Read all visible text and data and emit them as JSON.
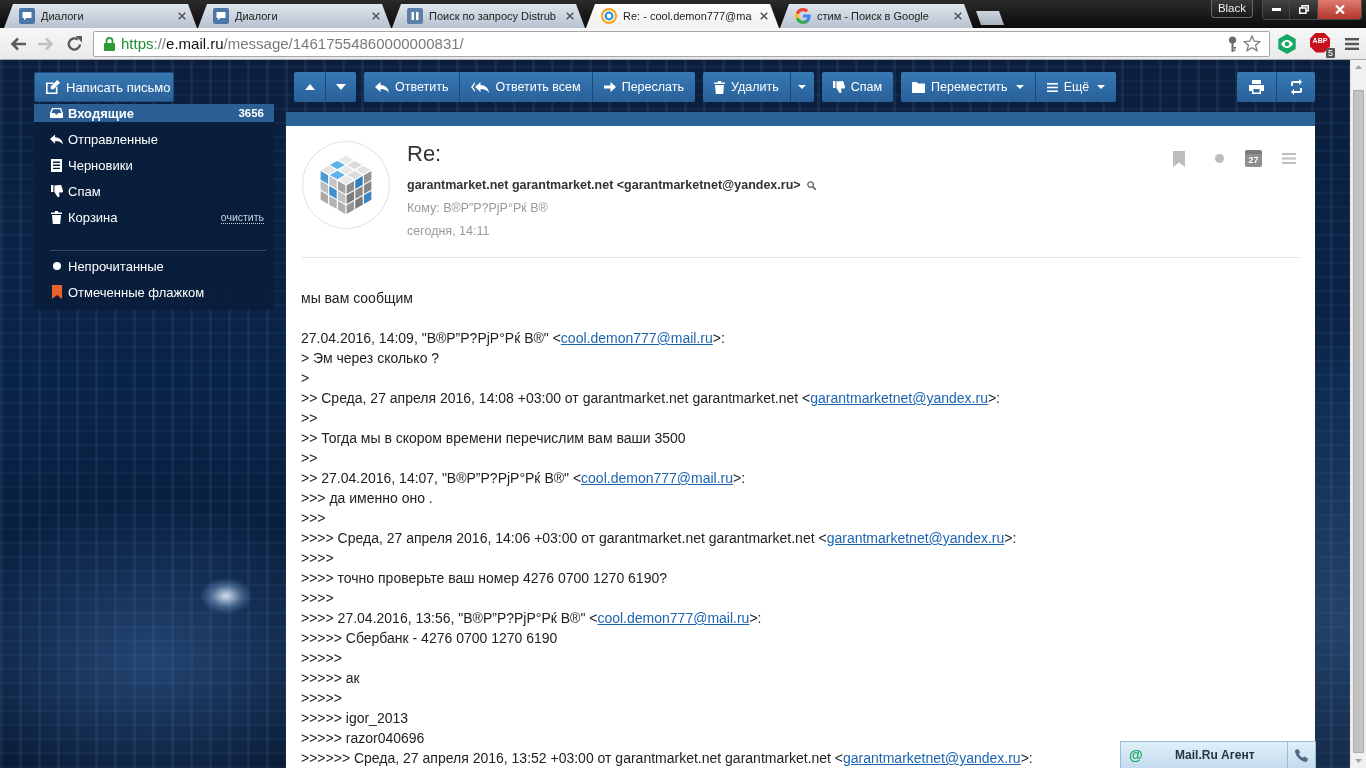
{
  "browser": {
    "tabs": [
      {
        "title": "Диалоги",
        "kind": "dialog",
        "selected": false
      },
      {
        "title": "Диалоги",
        "kind": "dialog",
        "selected": false
      },
      {
        "title": "Поиск по запросу Distrub",
        "kind": "pause",
        "selected": false
      },
      {
        "title": "Re: - cool.demon777@ma",
        "kind": "mail",
        "selected": true
      },
      {
        "title": "стим - Поиск в Google",
        "kind": "google",
        "selected": false
      }
    ],
    "profile": "Black",
    "nav": [
      {
        "kind": "back",
        "disabled": false
      },
      {
        "kind": "forward",
        "disabled": true
      },
      {
        "kind": "reload",
        "disabled": false
      }
    ],
    "url": {
      "scheme": "https",
      "separator": "://",
      "host": "e.mail.ru",
      "path": "/message/14617554860000000831/"
    },
    "adblock": {
      "label": "ABP",
      "count": "5"
    }
  },
  "sidebar": {
    "compose": "Написать письмо",
    "folders": [
      {
        "kind": "inbox",
        "label": "Входящие",
        "count": "3656",
        "selected": true
      },
      {
        "kind": "sent",
        "label": "Отправленные",
        "selected": false
      },
      {
        "kind": "drafts",
        "label": "Черновики",
        "selected": false
      },
      {
        "kind": "spam",
        "label": "Спам",
        "selected": false
      },
      {
        "kind": "trash",
        "label": "Корзина",
        "action": "очистить",
        "selected": false
      }
    ],
    "filters": [
      {
        "kind": "unread",
        "label": "Непрочитанные",
        "selected": false
      },
      {
        "kind": "flagged",
        "label": "Отмеченные флажком",
        "selected": false
      }
    ]
  },
  "toolbar": {
    "groups": [
      {
        "buttons": [
          {
            "kind": "up"
          },
          {
            "kind": "down"
          }
        ]
      },
      {
        "buttons": [
          {
            "kind": "reply",
            "label": "Ответить",
            "dropdown": false
          },
          {
            "kind": "reply_all",
            "label": "Ответить всем",
            "dropdown": false
          },
          {
            "kind": "forward",
            "label": "Переслать",
            "dropdown": false
          }
        ]
      },
      {
        "buttons": [
          {
            "kind": "delete",
            "label": "Удалить",
            "dropdown": false
          },
          {
            "kind": "caret"
          }
        ]
      },
      {
        "buttons": [
          {
            "kind": "spam",
            "label": "Спам",
            "dropdown": false
          }
        ]
      },
      {
        "buttons": [
          {
            "kind": "move",
            "label": "Переместить",
            "dropdown": true
          },
          {
            "kind": "more",
            "label": "Ещё",
            "dropdown": true
          }
        ]
      }
    ],
    "right": [
      {
        "kind": "print"
      },
      {
        "kind": "toggle"
      }
    ]
  },
  "message": {
    "subject": "Re:",
    "sender": "garantmarket.net garantmarket.net <garantmarketnet@yandex.ru>",
    "to": "Кому: В®Р”Р?РјР°Рќ В®",
    "date": "сегодня, 14:11",
    "calendar_day": "27",
    "greeting": "мы вам сообщим",
    "lines": [
      {
        "kind": "link",
        "before": "27.04.2016, 14:09, \"В®Р”Р?РјР°Рќ В®\" <",
        "link": "cool.demon777@mail.ru",
        "after": ">:"
      },
      {
        "kind": "plain",
        "text": "> Эм через сколько ?"
      },
      {
        "kind": "plain",
        "text": ">"
      },
      {
        "kind": "link",
        "before": ">> Среда, 27 апреля 2016, 14:08 +03:00 от garantmarket.net garantmarket.net <",
        "link": "garantmarketnet@yandex.ru",
        "after": ">:"
      },
      {
        "kind": "plain",
        "text": ">>"
      },
      {
        "kind": "plain",
        "text": ">> Тогда мы в скором времени перечислим вам ваши 3500"
      },
      {
        "kind": "plain",
        "text": ">>"
      },
      {
        "kind": "link",
        "before": ">> 27.04.2016, 14:07, \"В®Р”Р?РјР°Рќ В®\" <",
        "link": "cool.demon777@mail.ru",
        "after": ">:"
      },
      {
        "kind": "plain",
        "text": ">>> да именно оно ."
      },
      {
        "kind": "plain",
        "text": ">>>"
      },
      {
        "kind": "link",
        "before": ">>>> Среда, 27 апреля 2016, 14:06 +03:00 от garantmarket.net garantmarket.net <",
        "link": "garantmarketnet@yandex.ru",
        "after": ">:"
      },
      {
        "kind": "plain",
        "text": ">>>>"
      },
      {
        "kind": "plain",
        "text": ">>>> точно проверьте ваш номер 4276 0700 1270 6190?"
      },
      {
        "kind": "plain",
        "text": ">>>>"
      },
      {
        "kind": "link",
        "before": ">>>> 27.04.2016, 13:56, \"В®Р”Р?РјР°Рќ В®\" <",
        "link": "cool.demon777@mail.ru",
        "after": ">:"
      },
      {
        "kind": "plain",
        "text": ">>>>> Сбербанк - 4276 0700 1270 6190"
      },
      {
        "kind": "plain",
        "text": ">>>>>"
      },
      {
        "kind": "plain",
        "text": ">>>>> ак"
      },
      {
        "kind": "plain",
        "text": ">>>>>"
      },
      {
        "kind": "plain",
        "text": ">>>>> igor_2013"
      },
      {
        "kind": "plain",
        "text": ">>>>> razor040696"
      },
      {
        "kind": "link",
        "before": ">>>>>> Среда, 27 апреля 2016, 13:52 +03:00 от garantmarket.net garantmarket.net <",
        "link": "garantmarketnet@yandex.ru",
        "after": ">:"
      }
    ]
  },
  "agent": {
    "glyph": "@",
    "title": "Mail.Ru Агент"
  }
}
